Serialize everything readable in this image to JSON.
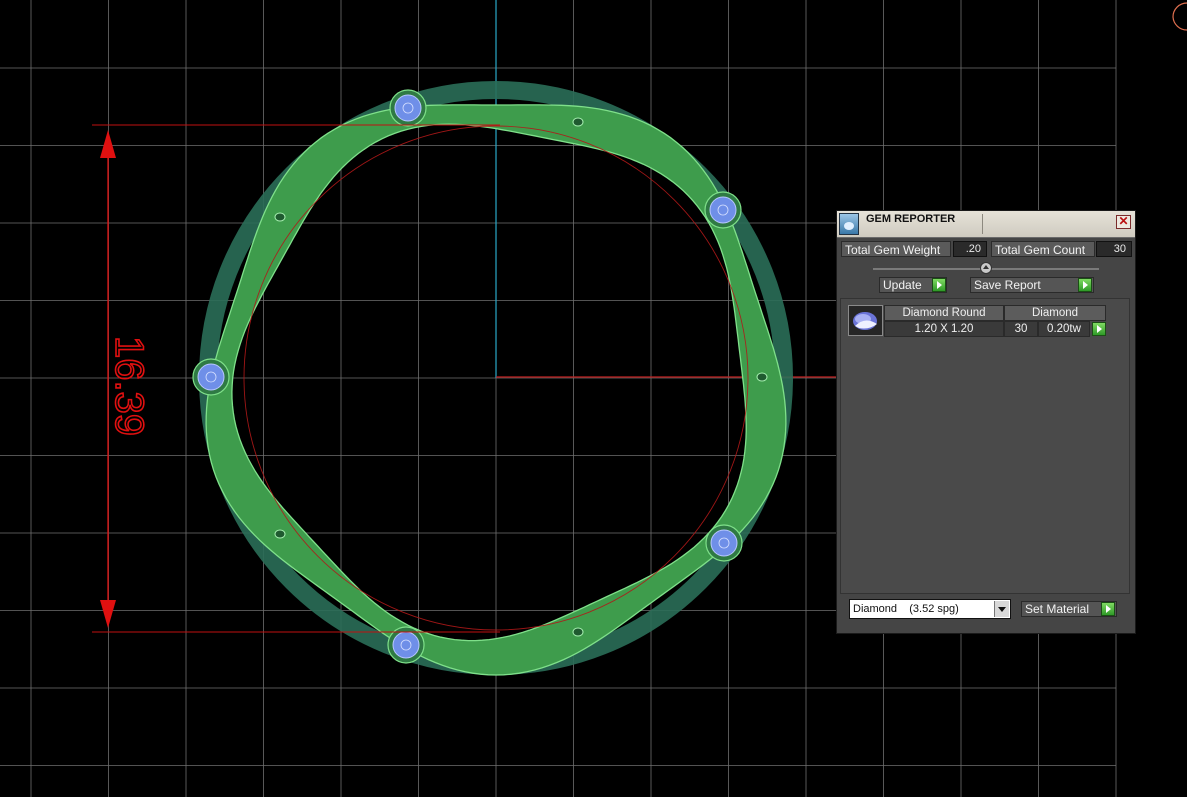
{
  "viewport": {
    "dimension_text": "16.39",
    "colors": {
      "grid": "#7f7f7f",
      "axis_vertical": "#2aa8c8",
      "axis_horizontal": "#c02020",
      "dimension": "#e01010",
      "ring": "#3e9c4c",
      "ring_highlight": "#7fe08a",
      "gem": "#6f8fe8"
    }
  },
  "gem_reporter": {
    "title": "GEM REPORTER",
    "close_label": "✕",
    "total_weight_label": "Total Gem Weight",
    "total_weight_value": ".20",
    "total_count_label": "Total Gem Count",
    "total_count_value": "30",
    "update_label": "Update",
    "save_report_label": "Save Report",
    "table": {
      "header_shape": "Diamond Round",
      "header_material": "Diamond",
      "size": "1.20 X 1.20",
      "count": "30",
      "weight": "0.20tw"
    },
    "material_select": "Diamond    (3.52 spg)",
    "set_material_label": "Set Material"
  }
}
